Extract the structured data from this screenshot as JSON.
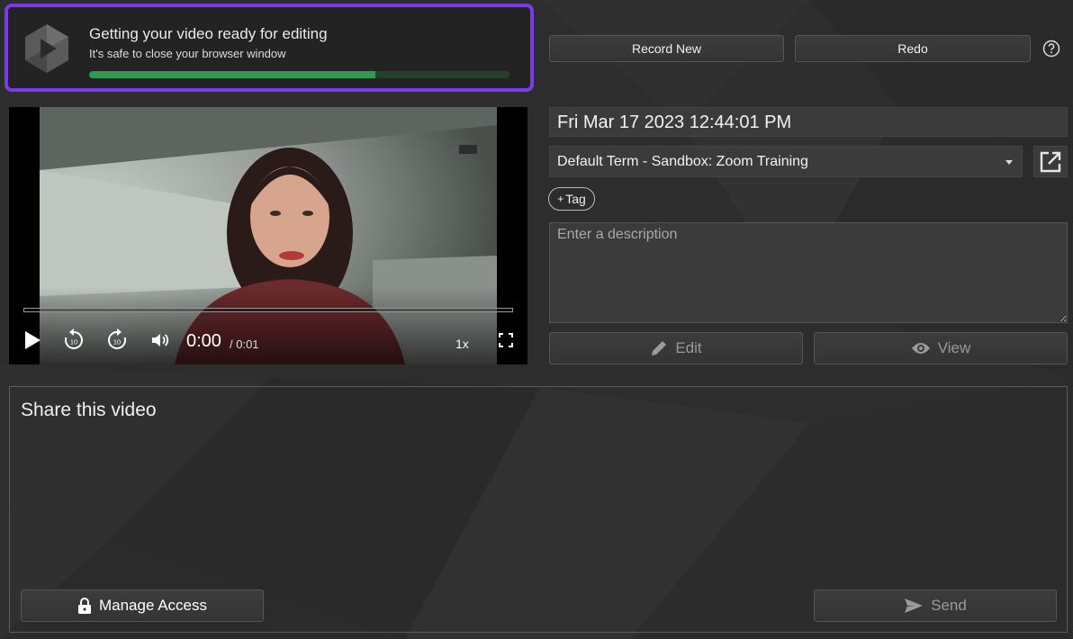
{
  "banner": {
    "title": "Getting your video ready for editing",
    "subtitle": "It's safe to close your browser window",
    "progress": 0.68,
    "logo_icon": "panopto-logo-icon",
    "accent_color": "#7c3aed",
    "progress_color": "#2f9a50"
  },
  "toolbar": {
    "record_new_label": "Record New",
    "redo_label": "Redo",
    "help_icon": "help-circle-icon"
  },
  "player": {
    "current_time": "0:00",
    "duration_text": "/ 0:01",
    "speed": "1x",
    "rewind_icon": "rewind-10-icon",
    "forward_icon": "forward-10-icon"
  },
  "details": {
    "date_value": "Fri Mar 17 2023 12:44:01 PM",
    "folder_value": "Default Term - Sandbox: Zoom Training",
    "tag_label": "Tag",
    "description_placeholder": "Enter a description",
    "edit_label": "Edit",
    "view_label": "View"
  },
  "share": {
    "title": "Share this video",
    "manage_access_label": "Manage Access",
    "send_label": "Send"
  }
}
